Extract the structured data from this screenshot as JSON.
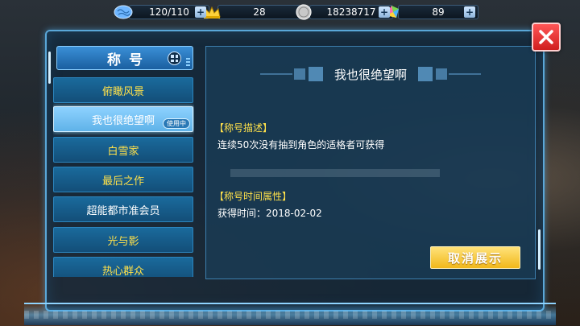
{
  "resources": [
    {
      "icon": "brain-icon",
      "value": "120/110",
      "color": "#6fb6ff"
    },
    {
      "icon": "gold-crown-icon",
      "value": "28",
      "color": "#ffd23a"
    },
    {
      "icon": "silver-coin-icon",
      "value": "18238717",
      "color": "#c8c8c8"
    },
    {
      "icon": "rainbow-crystal-icon",
      "value": "89",
      "color": "#7ad64c"
    }
  ],
  "left_panel": {
    "title": "称号",
    "items": [
      {
        "label": "俯瞰风景",
        "state": "normal"
      },
      {
        "label": "我也很绝望啊",
        "state": "selected",
        "badge": "使用中"
      },
      {
        "label": "白雪家",
        "state": "normal"
      },
      {
        "label": "最后之作",
        "state": "normal"
      },
      {
        "label": "超能都市准会员",
        "state": "normal"
      },
      {
        "label": "光与影",
        "state": "normal"
      },
      {
        "label": "热心群众",
        "state": "normal"
      }
    ]
  },
  "detail": {
    "title": "我也很绝望啊",
    "description_header": "【称号描述】",
    "description": "连续50次没有抽到角色的适格者可获得",
    "time_header": "【称号时间属性】",
    "obtained_label": "获得时间：",
    "obtained_date": "2018-02-02",
    "cancel_button": "取消展示"
  },
  "colors": {
    "accent": "#5aa7d8",
    "yellow_text": "#ffe14a",
    "button_gold": "#f1b81a",
    "close_red": "#d01e1e"
  }
}
